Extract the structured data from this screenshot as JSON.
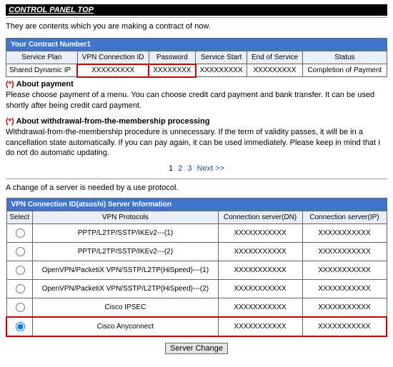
{
  "page_title": "CONTROL PANEL TOP",
  "intro_text": "They are contents which you are making a contract of now.",
  "contract_table": {
    "header": "Your Contract Number1",
    "columns": [
      "Service Plan",
      "VPN Connection ID",
      "Password",
      "Service Start",
      "End of Service",
      "Status"
    ],
    "row": {
      "plan": "Shared Dynamic IP",
      "vpn_id": "XXXXXXXXX",
      "password": "XXXXXXXX",
      "start": "XXXXXXXXX",
      "end": "XXXXXXXXX",
      "status": "Completion of Payment"
    }
  },
  "note_payment": {
    "bullet": "(*)",
    "title": "About payment",
    "body": "Please choose payment of a menu. You can choose credit card payment and bank transfer. It can be used shortly after being credit card payment."
  },
  "note_withdrawal": {
    "bullet": "(*)",
    "title": "About withdrawal-from-the-membership processing",
    "body": "Withdrawal-from-the-membership procedure is unnecessary. If the term of validity passes, it will be in a cancellation state automatically. If you can pay again, it can be used immediately. Please keep in mind that I do not do automatic updating."
  },
  "pager": {
    "p1": "1",
    "p2": "2",
    "p3": "3",
    "next": "Next >>"
  },
  "change_note": "A change of a server is needed by a use protocol.",
  "server_table": {
    "header": "VPN Connection ID(atsushi) Server Information",
    "columns": [
      "Select",
      "VPN Protocols",
      "Connection server(DN)",
      "Connection server(IP)"
    ],
    "rows": [
      {
        "protocol": "PPTP/L2TP/SSTP/IKEv2---(1)",
        "dn": "XXXXXXXXXXX",
        "ip": "XXXXXXXXXXX",
        "selected": false
      },
      {
        "protocol": "PPTP/L2TP/SSTP/IKEv2---(2)",
        "dn": "XXXXXXXXXXX",
        "ip": "XXXXXXXXXXX",
        "selected": false
      },
      {
        "protocol": "OpenVPN/PacketiX VPN/SSTP/L2TP(HiSpeed)---(1)",
        "dn": "XXXXXXXXXXX",
        "ip": "XXXXXXXXXXX",
        "selected": false
      },
      {
        "protocol": "OpenVPN/PacketiX VPN/SSTP/L2TP(HiSpeed)---(2)",
        "dn": "XXXXXXXXXXX",
        "ip": "XXXXXXXXXXX",
        "selected": false
      },
      {
        "protocol": "Cisco IPSEC",
        "dn": "XXXXXXXXXXX",
        "ip": "XXXXXXXXXXX",
        "selected": false
      },
      {
        "protocol": "Cisco Anyconnect",
        "dn": "XXXXXXXXXXX",
        "ip": "XXXXXXXXXXX",
        "selected": true
      }
    ]
  },
  "server_change_button": "Server Change"
}
